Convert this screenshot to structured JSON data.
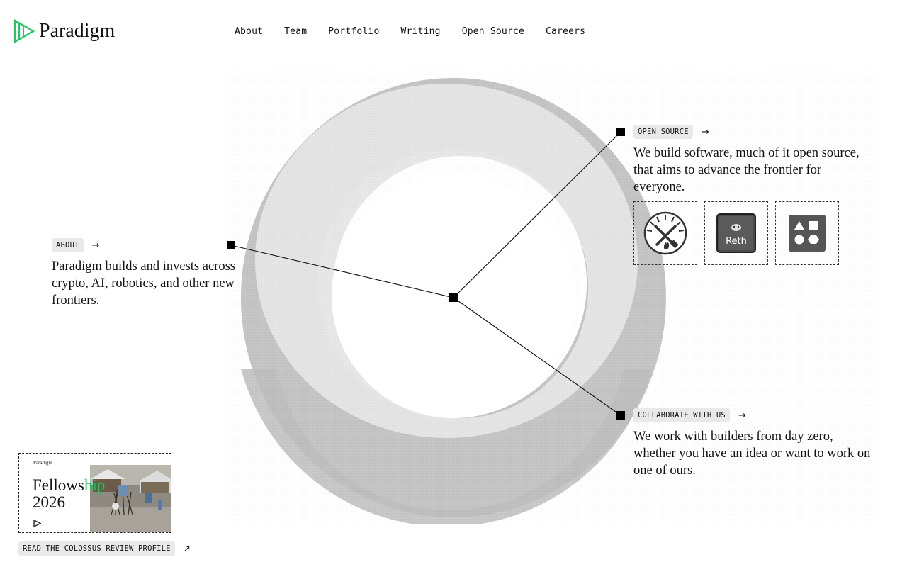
{
  "brand": {
    "name": "Paradigm",
    "logo_color": "#22c55e"
  },
  "nav": {
    "items": [
      {
        "label": "About"
      },
      {
        "label": "Team"
      },
      {
        "label": "Portfolio"
      },
      {
        "label": "Writing"
      },
      {
        "label": "Open Source"
      },
      {
        "label": "Careers"
      }
    ]
  },
  "about": {
    "tag": "ABOUT",
    "arrow": "→",
    "text": "Paradigm builds and invests across crypto, AI, robotics, and other new frontiers."
  },
  "open_source": {
    "tag": "OPEN SOURCE",
    "arrow": "→",
    "text": "We build software, much of it open source, that aims to advance the frontier for everyone.",
    "tools": [
      {
        "name": "foundry-icon"
      },
      {
        "name": "reth-icon",
        "label": "Reth"
      },
      {
        "name": "shapes-icon"
      }
    ]
  },
  "collaborate": {
    "tag": "COLLABORATE WITH US",
    "arrow": "→",
    "text": "We work with builders from day zero, whether you have an idea or want to work on one of ours."
  },
  "fellowship_card": {
    "brand": "Paradigm",
    "title_line1": "Fellowship",
    "title_line2": "2026",
    "link_label": "READ THE COLOSSUS REVIEW PROFILE",
    "link_arrow": "↗"
  },
  "colors": {
    "accent": "#22c55e",
    "pill_bg": "#e9e9e9",
    "ring_dark": "#bdbdbd",
    "ring_light": "#ededed"
  }
}
